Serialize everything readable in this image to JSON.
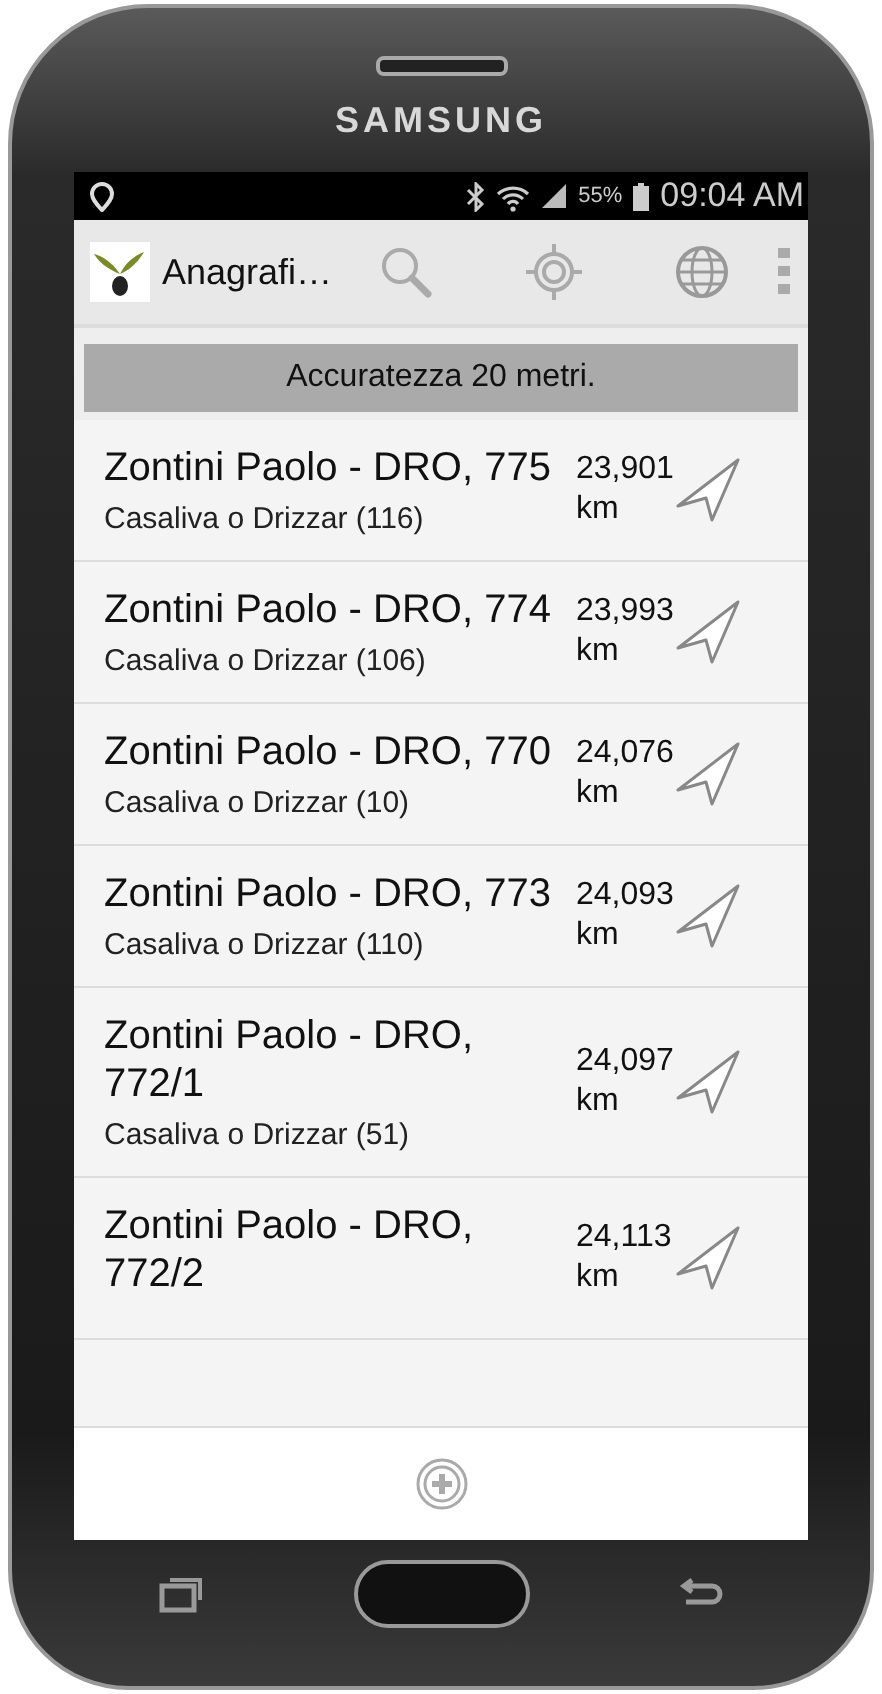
{
  "device": {
    "brand": "SAMSUNG"
  },
  "status_bar": {
    "battery": "55%",
    "time": "09:04 AM"
  },
  "action_bar": {
    "title": "Anagrafi…"
  },
  "banner": "Accuratezza 20 metri.",
  "rows": [
    {
      "title": "Zontini Paolo - DRO, 775",
      "subtitle": "Casaliva o Drizzar (116)",
      "distance": "23,901 km"
    },
    {
      "title": "Zontini Paolo - DRO, 774",
      "subtitle": "Casaliva o Drizzar (106)",
      "distance": "23,993 km"
    },
    {
      "title": "Zontini Paolo - DRO, 770",
      "subtitle": "Casaliva o Drizzar (10)",
      "distance": "24,076 km"
    },
    {
      "title": "Zontini Paolo - DRO, 773",
      "subtitle": "Casaliva o Drizzar (110)",
      "distance": "24,093 km"
    },
    {
      "title": "Zontini Paolo - DRO, 772/1",
      "subtitle": "Casaliva o Drizzar (51)",
      "distance": "24,097 km"
    },
    {
      "title": "Zontini Paolo - DRO, 772/2",
      "distance": "24,113 km"
    }
  ]
}
